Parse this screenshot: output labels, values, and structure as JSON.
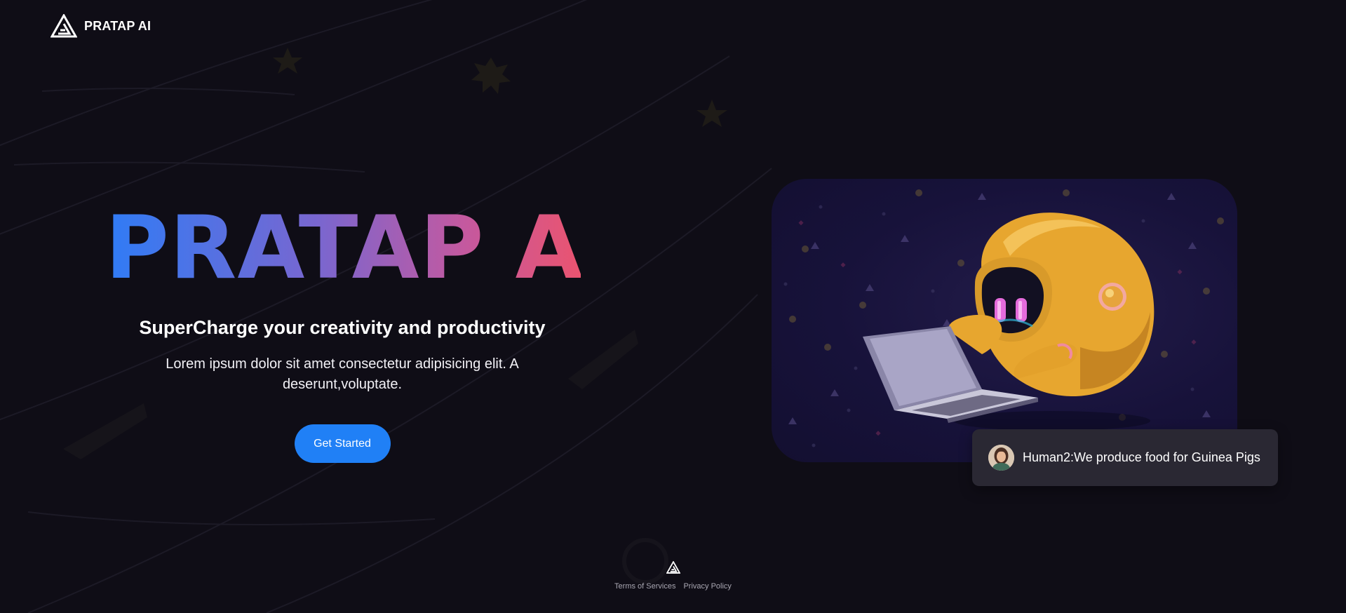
{
  "header": {
    "brand": "PRATAP AI",
    "logo_icon": "triangle-logo-icon"
  },
  "hero": {
    "title": "PRATAP AI",
    "subtitle": "SuperCharge your creativity and productivity",
    "description": "Lorem ipsum dolor sit amet consectetur adipisicing elit. A deserunt,voluptate.",
    "cta_label": "Get Started",
    "title_gradient": [
      "#2f7cf6",
      "#7a66cf",
      "#c359a0",
      "#ea5470"
    ],
    "cta_color": "#2080f6"
  },
  "chat": {
    "message": "Human2:We produce food for Guinea Pigs",
    "avatar_icon": "user-avatar-icon"
  },
  "footer": {
    "logo_icon": "triangle-logo-icon",
    "links": [
      "Terms of Services",
      "Privacy Policy"
    ]
  },
  "colors": {
    "background": "#0f0d16",
    "chat_bubble": "#2a2833",
    "robot": "#e8a531"
  }
}
